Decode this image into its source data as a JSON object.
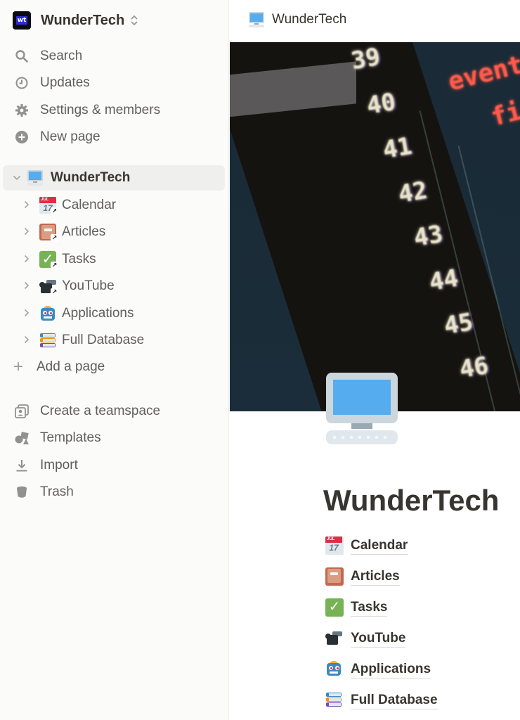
{
  "workspace": {
    "name": "WunderTech",
    "logo_text": "wt"
  },
  "sidebar": {
    "nav": [
      {
        "label": "Search",
        "icon": "search-icon"
      },
      {
        "label": "Updates",
        "icon": "clock-icon"
      },
      {
        "label": "Settings & members",
        "icon": "gear-icon"
      },
      {
        "label": "New page",
        "icon": "plus-circle-icon"
      }
    ],
    "tree": {
      "root": {
        "label": "WunderTech",
        "icon": "desktop-computer-icon",
        "expanded": true
      },
      "children": [
        {
          "label": "Calendar",
          "icon": "calendar-icon",
          "cal_month": "JUL",
          "cal_day": "17"
        },
        {
          "label": "Articles",
          "icon": "book-icon"
        },
        {
          "label": "Tasks",
          "icon": "check-mark-icon"
        },
        {
          "label": "YouTube",
          "icon": "video-camera-icon"
        },
        {
          "label": "Applications",
          "icon": "robot-icon"
        },
        {
          "label": "Full Database",
          "icon": "books-icon"
        }
      ]
    },
    "add_page_label": "Add a page",
    "footer": [
      {
        "label": "Create a teamspace",
        "icon": "teamspace-icon"
      },
      {
        "label": "Templates",
        "icon": "templates-icon"
      },
      {
        "label": "Import",
        "icon": "import-icon"
      },
      {
        "label": "Trash",
        "icon": "trash-icon"
      }
    ]
  },
  "topbar": {
    "breadcrumb": "WunderTech"
  },
  "cover": {
    "line_numbers": [
      "39",
      "40",
      "41",
      "42",
      "43",
      "44",
      "45",
      "46"
    ],
    "code_words": [
      "event",
      "fi"
    ]
  },
  "page": {
    "title": "WunderTech",
    "links": [
      {
        "label": "Calendar",
        "cal_month": "JUL",
        "cal_day": "17"
      },
      {
        "label": "Articles"
      },
      {
        "label": "Tasks"
      },
      {
        "label": "YouTube"
      },
      {
        "label": "Applications"
      },
      {
        "label": "Full Database"
      }
    ]
  }
}
